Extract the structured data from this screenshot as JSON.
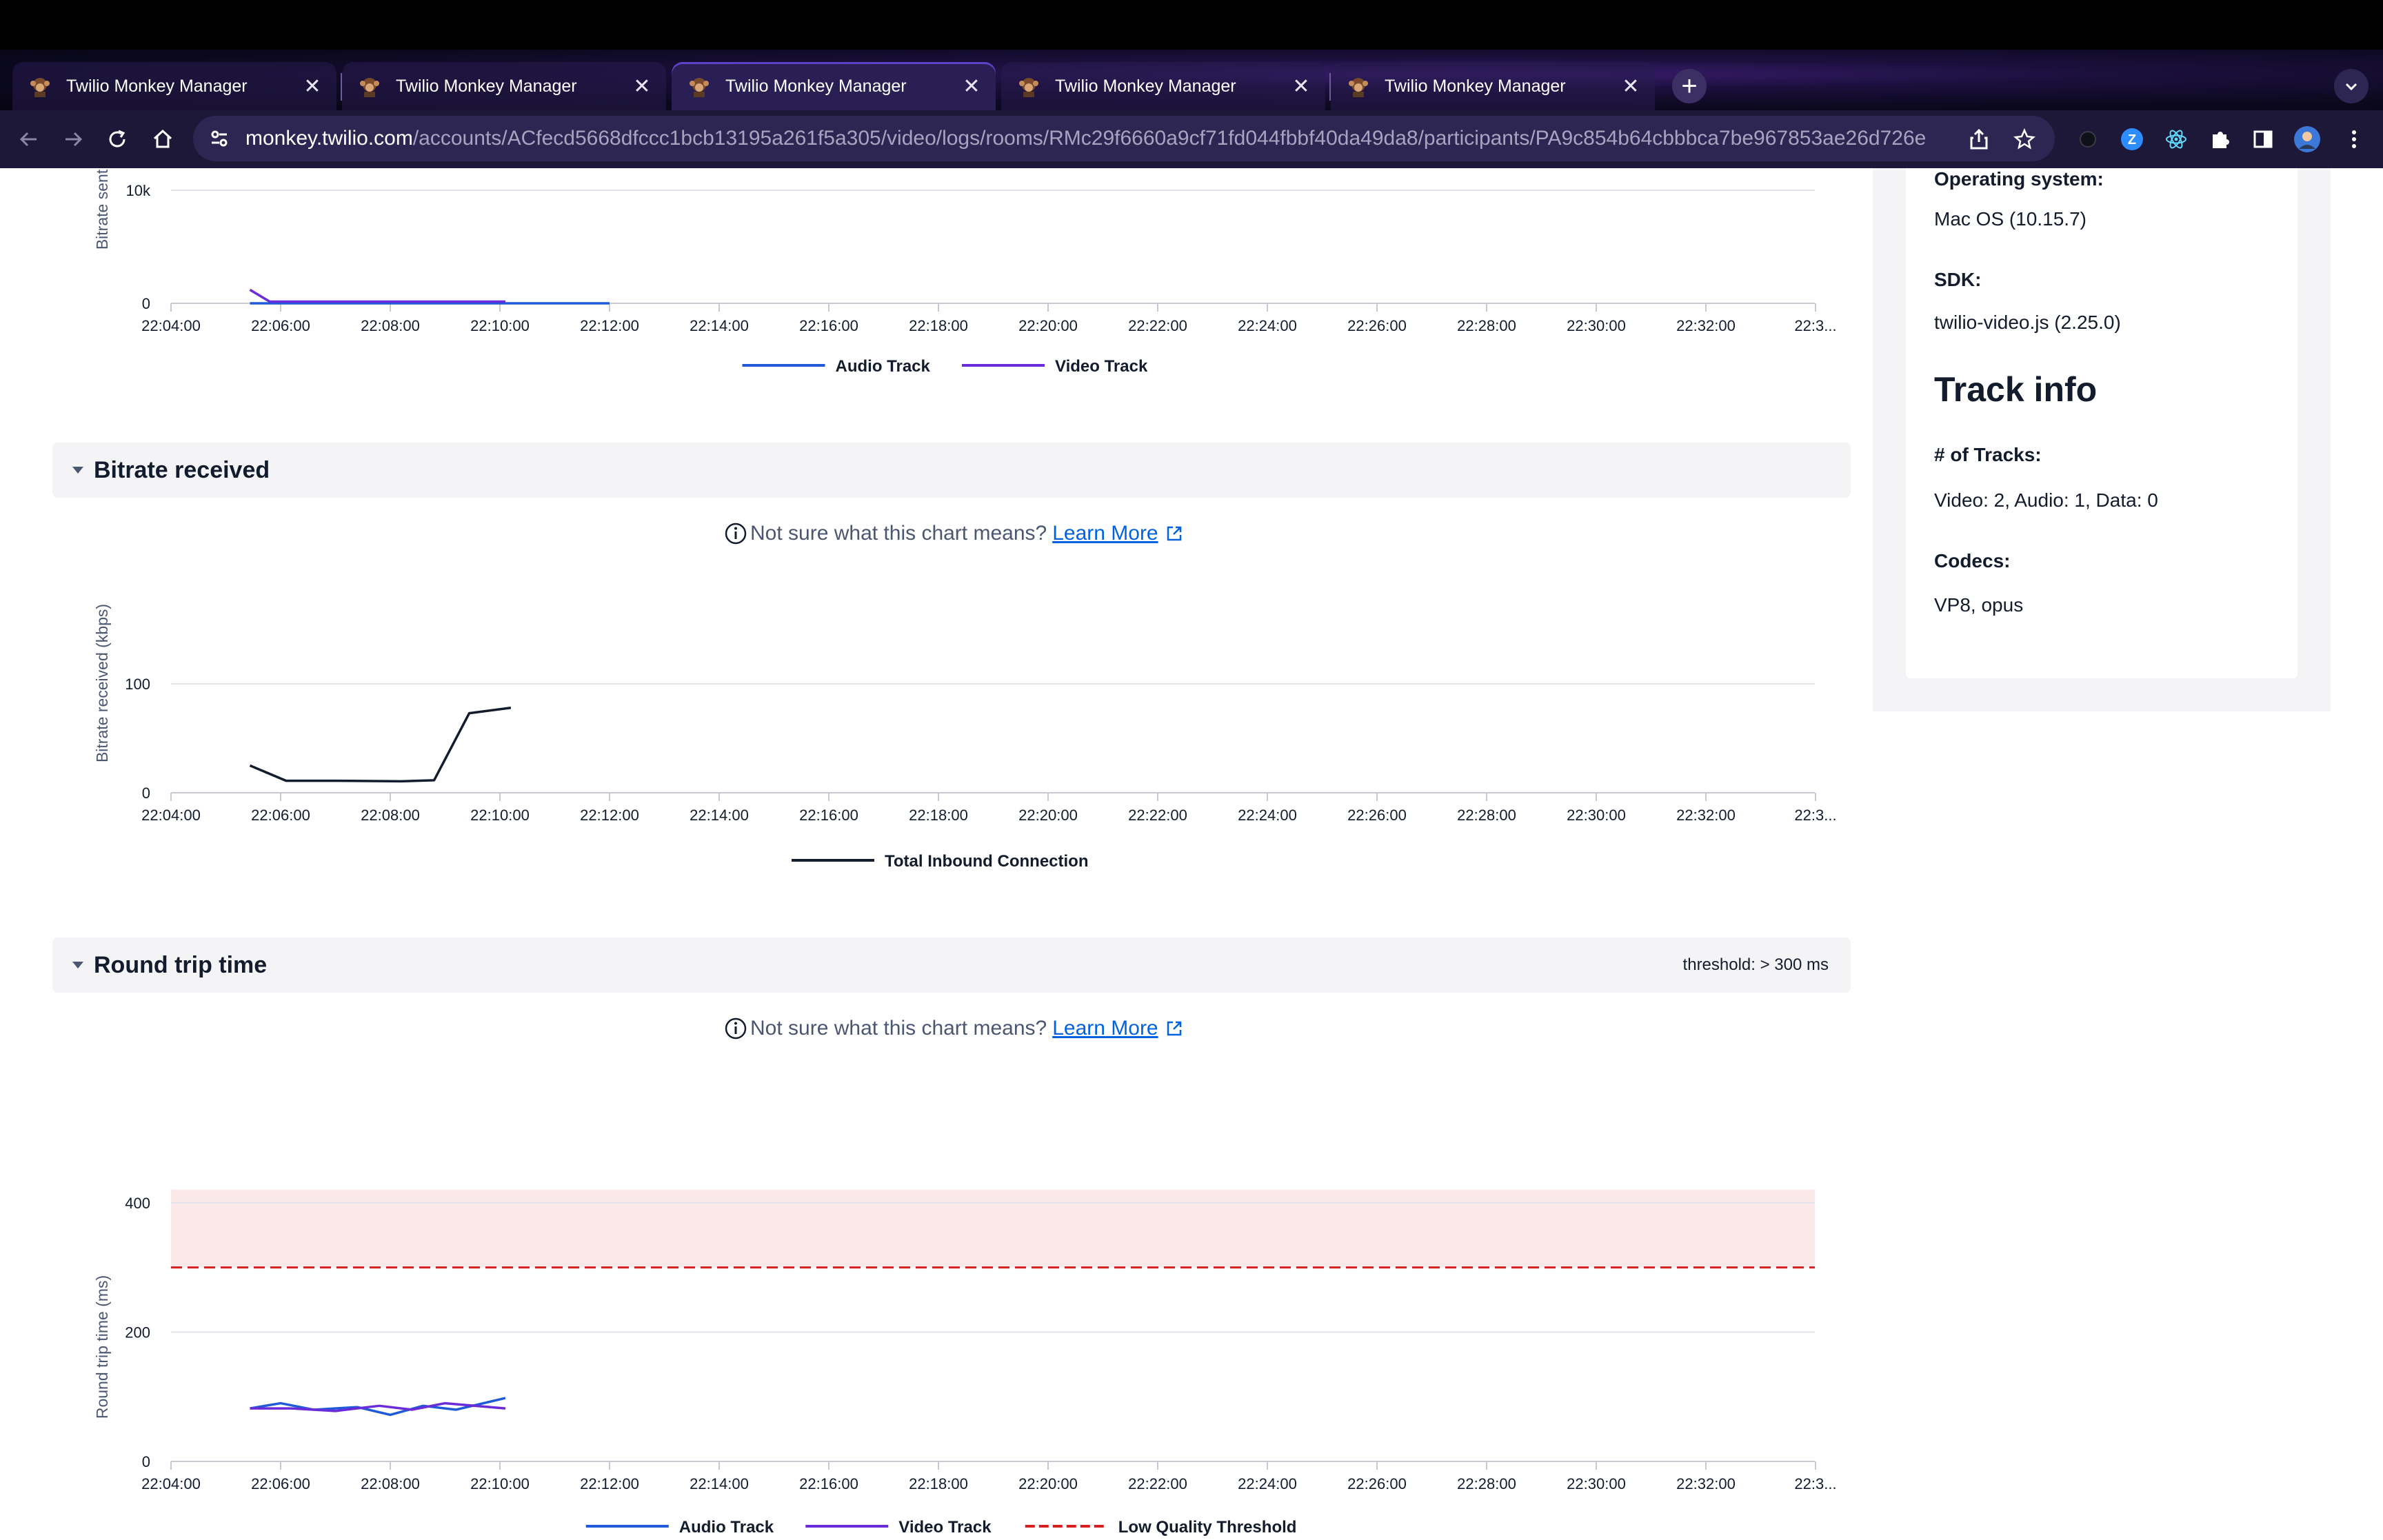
{
  "browser": {
    "tabs": [
      {
        "title": "Twilio Monkey Manager",
        "active": false
      },
      {
        "title": "Twilio Monkey Manager",
        "active": false
      },
      {
        "title": "Twilio Monkey Manager",
        "active": true
      },
      {
        "title": "Twilio Monkey Manager",
        "active": false
      },
      {
        "title": "Twilio Monkey Manager",
        "active": false
      }
    ],
    "url_host": "monkey.twilio.com",
    "url_path": "/accounts/ACfecd5668dfccc1bcb13195a261f5a305/video/logs/rooms/RMc29f6660a9cf71fd044fbbf40da49da8/participants/PA9c854b64cbbbca7be967853ae26d726e",
    "profile_badge": "Z"
  },
  "sections": {
    "bitrate_sent": {
      "chart_data": {
        "type": "line",
        "ylabel": "Bitrate sent",
        "yticks": [
          "0",
          "10k"
        ],
        "ylim": [
          0,
          10000
        ],
        "x": [
          "22:04:00",
          "22:06:00",
          "22:08:00",
          "22:10:00",
          "22:12:00",
          "22:14:00",
          "22:16:00",
          "22:18:00",
          "22:20:00",
          "22:22:00",
          "22:24:00",
          "22:26:00",
          "22:28:00",
          "22:30:00",
          "22:32:00",
          "22:3..."
        ],
        "series": [
          {
            "name": "Audio Track",
            "color": "#1f5bd8",
            "points": [
              [
                0.72,
                0
              ],
              [
                4.0,
                0
              ]
            ]
          },
          {
            "name": "Video Track",
            "color": "#6a2bd9",
            "points": [
              [
                0.72,
                1200
              ],
              [
                0.9,
                150
              ],
              [
                2.0,
                150
              ],
              [
                3.05,
                150
              ]
            ]
          }
        ]
      }
    },
    "bitrate_received": {
      "title": "Bitrate received",
      "info_text": "Not sure what this chart means?",
      "learn_more": " Learn More",
      "chart_data": {
        "type": "line",
        "ylabel": "Bitrate received (kbps)",
        "yticks": [
          "0",
          "100"
        ],
        "ylim": [
          0,
          100
        ],
        "x": [
          "22:04:00",
          "22:06:00",
          "22:08:00",
          "22:10:00",
          "22:12:00",
          "22:14:00",
          "22:16:00",
          "22:18:00",
          "22:20:00",
          "22:22:00",
          "22:24:00",
          "22:26:00",
          "22:28:00",
          "22:30:00",
          "22:32:00",
          "22:3..."
        ],
        "series": [
          {
            "name": "Total Inbound Connection",
            "color": "#121c2d",
            "points": [
              [
                0.72,
                25
              ],
              [
                1.05,
                11
              ],
              [
                1.5,
                11
              ],
              [
                2.1,
                10.5
              ],
              [
                2.4,
                11.5
              ],
              [
                2.72,
                73
              ],
              [
                3.1,
                78
              ]
            ]
          }
        ]
      }
    },
    "round_trip_time": {
      "title": "Round trip time",
      "threshold_label": "threshold: > 300 ms",
      "info_text": "Not sure what this chart means?",
      "learn_more": " Learn More",
      "chart_data": {
        "type": "line",
        "ylabel": "Round trip time (ms)",
        "yticks": [
          "0",
          "200",
          "400"
        ],
        "ylim": [
          0,
          420
        ],
        "threshold": 300,
        "x": [
          "22:04:00",
          "22:06:00",
          "22:08:00",
          "22:10:00",
          "22:12:00",
          "22:14:00",
          "22:16:00",
          "22:18:00",
          "22:20:00",
          "22:22:00",
          "22:24:00",
          "22:26:00",
          "22:28:00",
          "22:30:00",
          "22:32:00",
          "22:3..."
        ],
        "series": [
          {
            "name": "Audio Track",
            "color": "#1f5bd8",
            "points": [
              [
                0.72,
                82
              ],
              [
                1.0,
                90
              ],
              [
                1.3,
                80
              ],
              [
                1.7,
                84
              ],
              [
                2.0,
                72
              ],
              [
                2.3,
                86
              ],
              [
                2.6,
                80
              ],
              [
                3.05,
                98
              ]
            ]
          },
          {
            "name": "Video Track",
            "color": "#6a2bd9",
            "points": [
              [
                0.72,
                82
              ],
              [
                1.1,
                82
              ],
              [
                1.5,
                78
              ],
              [
                1.9,
                86
              ],
              [
                2.2,
                80
              ],
              [
                2.5,
                90
              ],
              [
                3.05,
                82
              ]
            ]
          },
          {
            "name": "Low Quality Threshold",
            "color": "#d61f1f",
            "dashed": true,
            "points": []
          }
        ]
      }
    }
  },
  "sidebar": {
    "os_label": "Operating system:",
    "os_value": "Mac OS (10.15.7)",
    "sdk_label": "SDK:",
    "sdk_value": "twilio-video.js (2.25.0)",
    "track_heading": "Track info",
    "tracks_label": "# of Tracks:",
    "tracks_value": "Video: 2, Audio: 1, Data: 0",
    "codecs_label": "Codecs:",
    "codecs_value": "VP8, opus"
  }
}
